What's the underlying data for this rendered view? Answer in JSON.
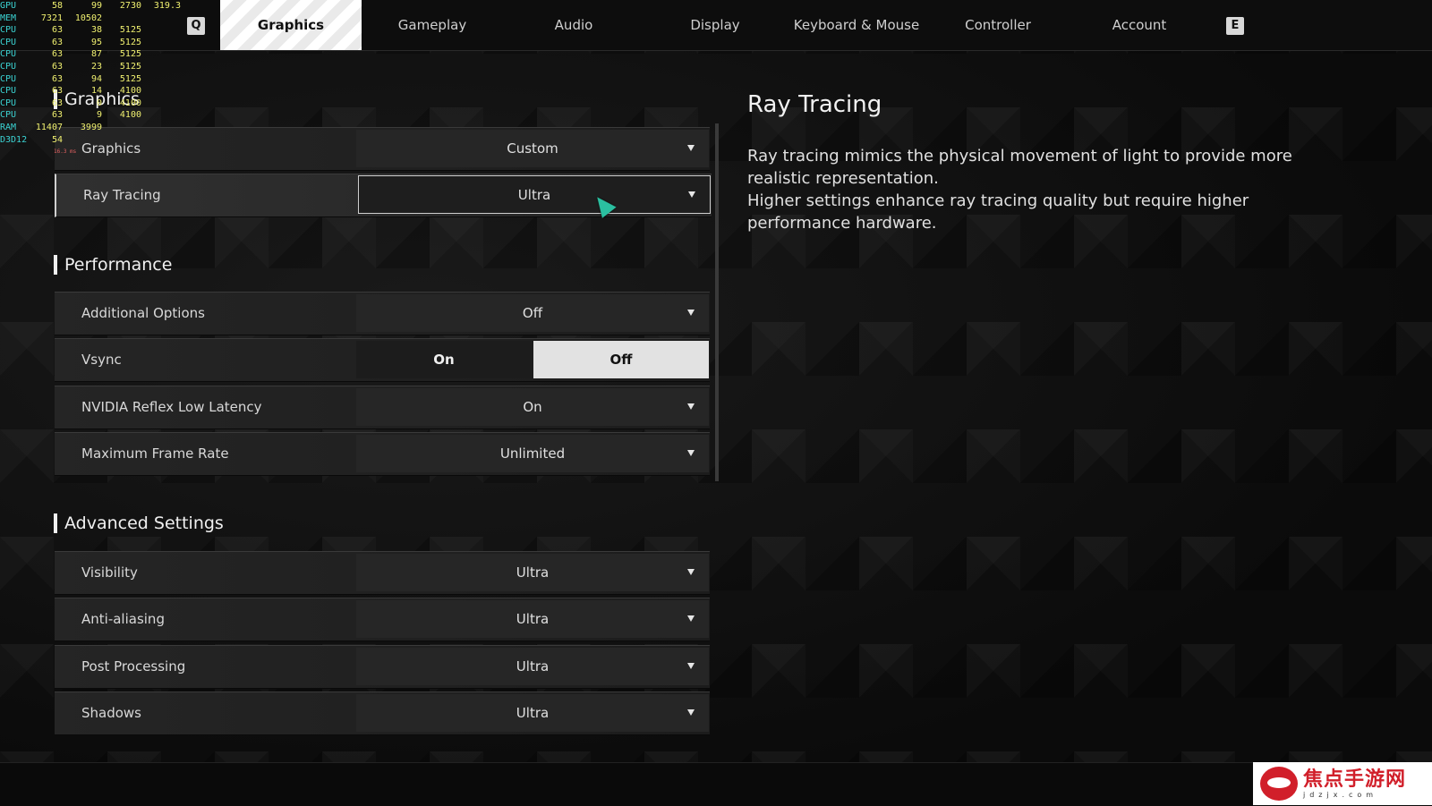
{
  "nav": {
    "prev_key": "Q",
    "next_key": "E",
    "tabs": [
      {
        "label": "Graphics",
        "active": true
      },
      {
        "label": "Gameplay"
      },
      {
        "label": "Audio"
      },
      {
        "label": "Display"
      },
      {
        "label": "Keyboard & Mouse"
      },
      {
        "label": "Controller"
      },
      {
        "label": "Account"
      }
    ]
  },
  "overlay": {
    "rows": [
      {
        "label": "GPU",
        "a": "58",
        "b": "99",
        "c": "2730",
        "d": "319.3"
      },
      {
        "label": "MEM",
        "a": "7321",
        "b": "10502",
        "c": "",
        "d": ""
      },
      {
        "label": "CPU",
        "a": "63",
        "b": "38",
        "c": "5125",
        "d": ""
      },
      {
        "label": "CPU",
        "a": "63",
        "b": "95",
        "c": "5125",
        "d": ""
      },
      {
        "label": "CPU",
        "a": "63",
        "b": "87",
        "c": "5125",
        "d": ""
      },
      {
        "label": "CPU",
        "a": "63",
        "b": "23",
        "c": "5125",
        "d": ""
      },
      {
        "label": "CPU",
        "a": "63",
        "b": "94",
        "c": "5125",
        "d": ""
      },
      {
        "label": "CPU",
        "a": "63",
        "b": "14",
        "c": "4100",
        "d": ""
      },
      {
        "label": "CPU",
        "a": "63",
        "b": "0",
        "c": "4100",
        "d": ""
      },
      {
        "label": "CPU",
        "a": "63",
        "b": "9",
        "c": "4100",
        "d": ""
      },
      {
        "label": "RAM",
        "a": "11407",
        "b": "3999",
        "c": "",
        "d": ""
      },
      {
        "label": "D3D12",
        "a": "54",
        "b": "",
        "c": "",
        "d": ""
      }
    ],
    "frametime": "16.3 ms"
  },
  "sections": {
    "graphics": "Graphics",
    "performance": "Performance",
    "advanced": "Advanced Settings"
  },
  "settings": {
    "graphics": {
      "label": "Graphics",
      "value": "Custom"
    },
    "ray_tracing": {
      "label": "Ray Tracing",
      "value": "Ultra"
    },
    "additional_options": {
      "label": "Additional Options",
      "value": "Off"
    },
    "vsync": {
      "label": "Vsync",
      "on": "On",
      "off": "Off",
      "selected": "Off"
    },
    "reflex": {
      "label": "NVIDIA Reflex Low Latency",
      "value": "On"
    },
    "max_fps": {
      "label": "Maximum Frame Rate",
      "value": "Unlimited"
    },
    "visibility": {
      "label": "Visibility",
      "value": "Ultra"
    },
    "anti_aliasing": {
      "label": "Anti-aliasing",
      "value": "Ultra"
    },
    "post_processing": {
      "label": "Post Processing",
      "value": "Ultra"
    },
    "shadows": {
      "label": "Shadows",
      "value": "Ultra"
    }
  },
  "info": {
    "title": "Ray Tracing",
    "line1": "Ray tracing mimics the physical movement of light to provide more realistic representation.",
    "line2": "Higher settings enhance ray tracing quality but require higher performance hardware."
  },
  "watermark": {
    "cn": "焦点手游网",
    "url": "jdzjx.com"
  },
  "icons": [
    "dropdown-caret-icon",
    "mouse-cursor-icon",
    "watermark-logo-icon"
  ]
}
